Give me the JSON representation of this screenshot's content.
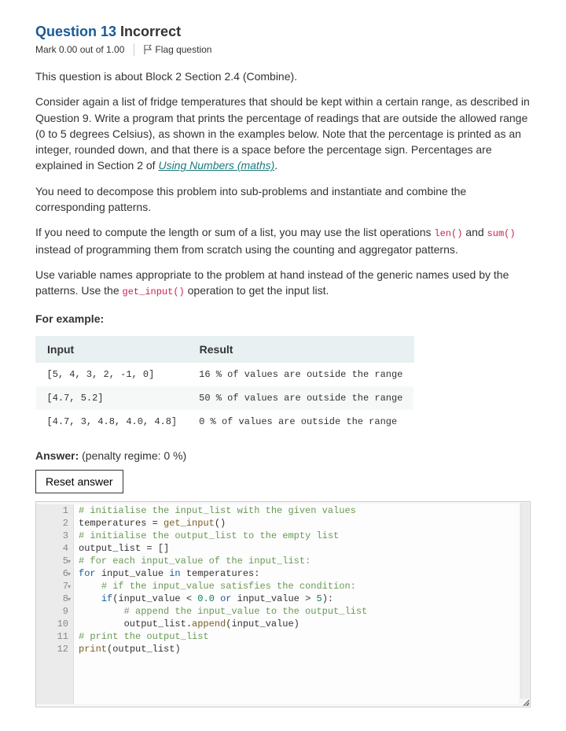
{
  "header": {
    "question_label": "Question 13",
    "status": "Incorrect",
    "mark_text": "Mark 0.00 out of 1.00",
    "flag_text": "Flag question"
  },
  "body": {
    "p1": "This question is about Block 2 Section 2.4 (Combine).",
    "p2a": "Consider again a list of fridge temperatures that should be kept within a certain range, as described in Question 9. Write a program that prints the percentage of readings that are outside the allowed range (0 to 5 degrees Celsius), as shown in the examples below. Note that the percentage is printed as an integer, rounded down, and that there is a space before the percentage sign. Percentages are explained in Section 2 of ",
    "p2_link": "Using Numbers (maths)",
    "p2b": ".",
    "p3": "You need to decompose this problem into sub-problems and instantiate and combine the corresponding patterns.",
    "p4a": "If you need to compute the length or sum of a list, you may use the list operations ",
    "p4_code1": "len()",
    "p4_mid": " and ",
    "p4_code2": "sum()",
    "p4b": " instead of programming them from scratch using the counting and aggregator patterns.",
    "p5a": "Use variable names appropriate to the problem at hand instead of the generic names used by the patterns. Use the ",
    "p5_code": "get_input()",
    "p5b": " operation to get the input list.",
    "example_label": "For example:"
  },
  "example_table": {
    "headers": [
      "Input",
      "Result"
    ],
    "rows": [
      {
        "input": "[5, 4, 3, 2, -1, 0]",
        "result": "16 % of values are outside the range"
      },
      {
        "input": "[4.7, 5.2]",
        "result": "50 % of values are outside the range"
      },
      {
        "input": "[4.7, 3, 4.8, 4.0, 4.8]",
        "result": "0 % of values are outside the range"
      }
    ]
  },
  "answer": {
    "label": "Answer:",
    "penalty": "(penalty regime: 0 %)",
    "reset_btn": "Reset answer"
  },
  "code": {
    "lines": [
      {
        "n": 1,
        "fold": false,
        "tokens": [
          [
            "comment",
            "# initialise the input_list with the given values"
          ]
        ]
      },
      {
        "n": 2,
        "fold": false,
        "tokens": [
          [
            "ident",
            "temperatures "
          ],
          [
            "op",
            "= "
          ],
          [
            "func",
            "get_input"
          ],
          [
            "op",
            "()"
          ]
        ]
      },
      {
        "n": 3,
        "fold": false,
        "tokens": [
          [
            "comment",
            "# initialise the output_list to the empty list"
          ]
        ]
      },
      {
        "n": 4,
        "fold": false,
        "tokens": [
          [
            "ident",
            "output_list "
          ],
          [
            "op",
            "= []"
          ]
        ]
      },
      {
        "n": 5,
        "fold": true,
        "tokens": [
          [
            "comment",
            "# for each input_value of the input_list:"
          ]
        ]
      },
      {
        "n": 6,
        "fold": true,
        "tokens": [
          [
            "keyword",
            "for "
          ],
          [
            "ident",
            "input_value "
          ],
          [
            "keyword",
            "in "
          ],
          [
            "ident",
            "temperatures"
          ],
          [
            "op",
            ":"
          ]
        ]
      },
      {
        "n": 7,
        "fold": true,
        "tokens": [
          [
            "ident",
            "    "
          ],
          [
            "comment",
            "# if the input_value satisfies the condition:"
          ]
        ]
      },
      {
        "n": 8,
        "fold": true,
        "tokens": [
          [
            "ident",
            "    "
          ],
          [
            "keyword",
            "if"
          ],
          [
            "op",
            "("
          ],
          [
            "ident",
            "input_value "
          ],
          [
            "op",
            "< "
          ],
          [
            "num",
            "0.0"
          ],
          [
            "op",
            " "
          ],
          [
            "keyword",
            "or"
          ],
          [
            "op",
            " "
          ],
          [
            "ident",
            "input_value "
          ],
          [
            "op",
            "> "
          ],
          [
            "num",
            "5"
          ],
          [
            "op",
            "):"
          ]
        ]
      },
      {
        "n": 9,
        "fold": false,
        "tokens": [
          [
            "ident",
            "        "
          ],
          [
            "comment",
            "# append the input_value to the output_list"
          ]
        ]
      },
      {
        "n": 10,
        "fold": false,
        "tokens": [
          [
            "ident",
            "        "
          ],
          [
            "ident",
            "output_list"
          ],
          [
            "op",
            "."
          ],
          [
            "func",
            "append"
          ],
          [
            "op",
            "("
          ],
          [
            "ident",
            "input_value"
          ],
          [
            "op",
            ")"
          ]
        ]
      },
      {
        "n": 11,
        "fold": false,
        "tokens": [
          [
            "comment",
            "# print the output_list"
          ]
        ]
      },
      {
        "n": 12,
        "fold": false,
        "tokens": [
          [
            "func",
            "print"
          ],
          [
            "op",
            "("
          ],
          [
            "ident",
            "output_list"
          ],
          [
            "op",
            ")"
          ]
        ]
      }
    ]
  }
}
